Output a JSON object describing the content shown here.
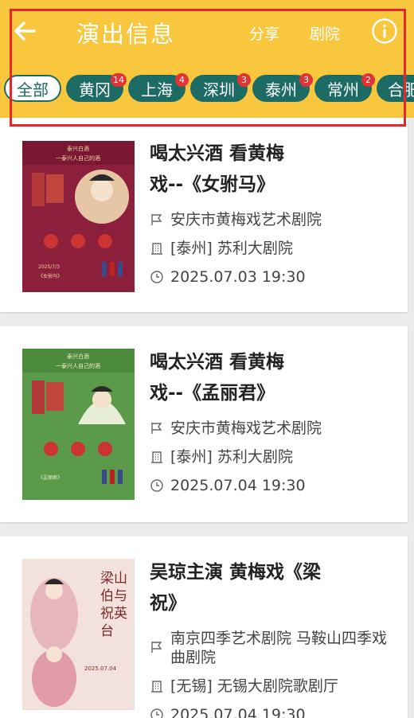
{
  "header": {
    "title": "演出信息",
    "share_label": "分享",
    "theater_label": "剧院",
    "background_color": "#f8c73d",
    "back_icon": "arrow-left-icon",
    "info_icon": "info-circle-icon"
  },
  "tabs": [
    {
      "label": "全部",
      "active": true
    },
    {
      "label": "黄冈",
      "badge": "14"
    },
    {
      "label": "上海",
      "badge": "4"
    },
    {
      "label": "深圳",
      "badge": "3"
    },
    {
      "label": "泰州",
      "badge": "3"
    },
    {
      "label": "常州",
      "badge": "2"
    },
    {
      "label": "合肥"
    }
  ],
  "shows": [
    {
      "title": "喝太兴酒 看黄梅戏--《女驸马》",
      "title_line1": "喝太兴酒 看黄梅",
      "title_line2": "戏--《女驸马》",
      "troupe": "安庆市黄梅戏艺术剧院",
      "venue": "[泰州] 苏利大剧院",
      "time": "2025.07.03 19:30",
      "poster": {
        "brand": "泰兴白酒",
        "slogan": "一泰兴人自己的酒",
        "date": "2025/7/3",
        "play": "《女驸马》",
        "color": "#8b1f3c"
      }
    },
    {
      "title": "喝太兴酒 看黄梅戏--《孟丽君》",
      "title_line1": "喝太兴酒 看黄梅",
      "title_line2": "戏--《孟丽君》",
      "troupe": "安庆市黄梅戏艺术剧院",
      "venue": "[泰州] 苏利大剧院",
      "time": "2025.07.04 19:30",
      "poster": {
        "brand": "泰兴白酒",
        "slogan": "一泰兴人自己的酒",
        "play": "《孟丽君》",
        "color": "#5a9a4a"
      }
    },
    {
      "title": "吴琼主演 黄梅戏《梁祝》",
      "title_line1": "吴琼主演 黄梅戏《梁",
      "title_line2": "祝》",
      "troupe": "南京四季艺术剧院 马鞍山四季戏曲剧院",
      "venue": "[无锡] 无锡大剧院歌剧厅",
      "time": "2025.07.04 19:30",
      "poster": {
        "play": "梁山伯与祝英台",
        "date": "2025.07.04",
        "color": "#f3e1dd"
      }
    }
  ],
  "icons": {
    "troupe": "flag-icon",
    "venue": "building-icon",
    "time": "clock-icon"
  }
}
